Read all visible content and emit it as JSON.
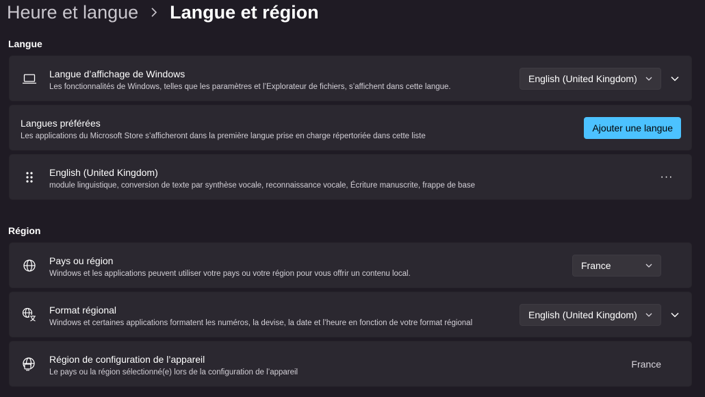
{
  "breadcrumb": {
    "parent": "Heure et langue",
    "current": "Langue et région"
  },
  "sections": {
    "language": "Langue",
    "region": "Région"
  },
  "display_language": {
    "title": "Langue d’affichage de Windows",
    "description": "Les fonctionnalités de Windows, telles que les paramètres et l’Explorateur de fichiers, s’affichent dans cette langue.",
    "value": "English (United Kingdom)",
    "icon": "laptop-icon"
  },
  "preferred_languages": {
    "title": "Langues préférées",
    "description": "Les applications du Microsoft Store s’afficheront dans la première langue prise en charge répertoriée dans cette liste",
    "button": "Ajouter une langue"
  },
  "language_item": {
    "title": "English (United Kingdom)",
    "description": "module linguistique, conversion de texte par synthèse vocale, reconnaissance vocale, Écriture manuscrite, frappe de base",
    "more": "···",
    "icon": "drag-handle-icon"
  },
  "country_region": {
    "title": "Pays ou région",
    "description": "Windows et les applications peuvent utiliser votre pays ou votre région pour vous offrir un contenu local.",
    "value": "France",
    "icon": "globe-icon"
  },
  "regional_format": {
    "title": "Format régional",
    "description": "Windows et certaines applications formatent les numéros, la devise, la date et l’heure en fonction de votre format régional",
    "value": "English (United Kingdom)",
    "icon": "regional-format-icon"
  },
  "device_region": {
    "title": "Région de configuration de l’appareil",
    "description": "Le pays ou la région sélectionné(e) lors de la configuration de l’appareil",
    "value": "France",
    "icon": "globe-device-icon"
  },
  "colors": {
    "background": "#1f1b24",
    "card": "#2b2830",
    "accent": "#4cc2ff"
  }
}
